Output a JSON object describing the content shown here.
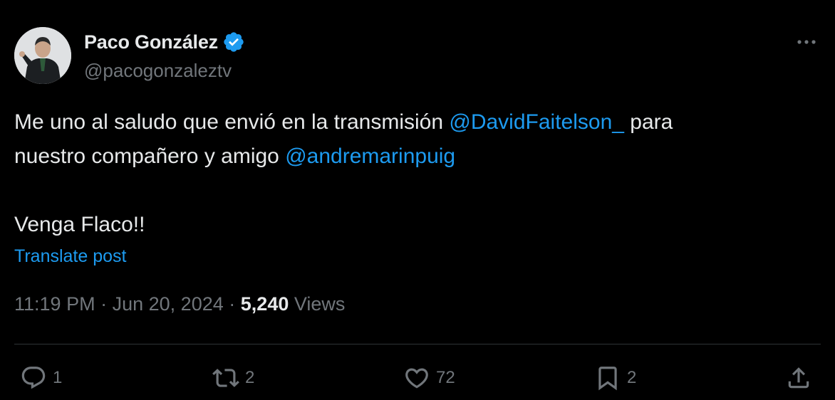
{
  "colors": {
    "background": "#000000",
    "primary_text": "#e7e9ea",
    "secondary_text": "#71767b",
    "accent_link": "#1d9bf0",
    "divider": "#2f3336"
  },
  "author": {
    "display_name": "Paco González",
    "handle": "@pacogonzaleztv",
    "verified_icon": "verified-badge-icon",
    "avatar_icon": "profile-photo"
  },
  "post": {
    "line1_prefix": "Me uno al saludo que envió en la transmisión ",
    "mention1": "@DavidFaitelson_",
    "line1_suffix": " para",
    "line2_prefix": "nuestro compañero y amigo ",
    "mention2": "@andremarinpuig",
    "line3": "Venga Flaco!!"
  },
  "translate_label": "Translate post",
  "meta": {
    "time": "11:19 PM",
    "separator": "·",
    "date": "Jun 20, 2024",
    "views_count": "5,240",
    "views_label": "Views"
  },
  "actions": {
    "reply": {
      "icon": "reply-icon",
      "count": "1"
    },
    "repost": {
      "icon": "repost-icon",
      "count": "2"
    },
    "like": {
      "icon": "heart-icon",
      "count": "72"
    },
    "bookmark": {
      "icon": "bookmark-icon",
      "count": "2"
    },
    "share": {
      "icon": "share-icon"
    }
  },
  "more_icon": "more-options-icon"
}
